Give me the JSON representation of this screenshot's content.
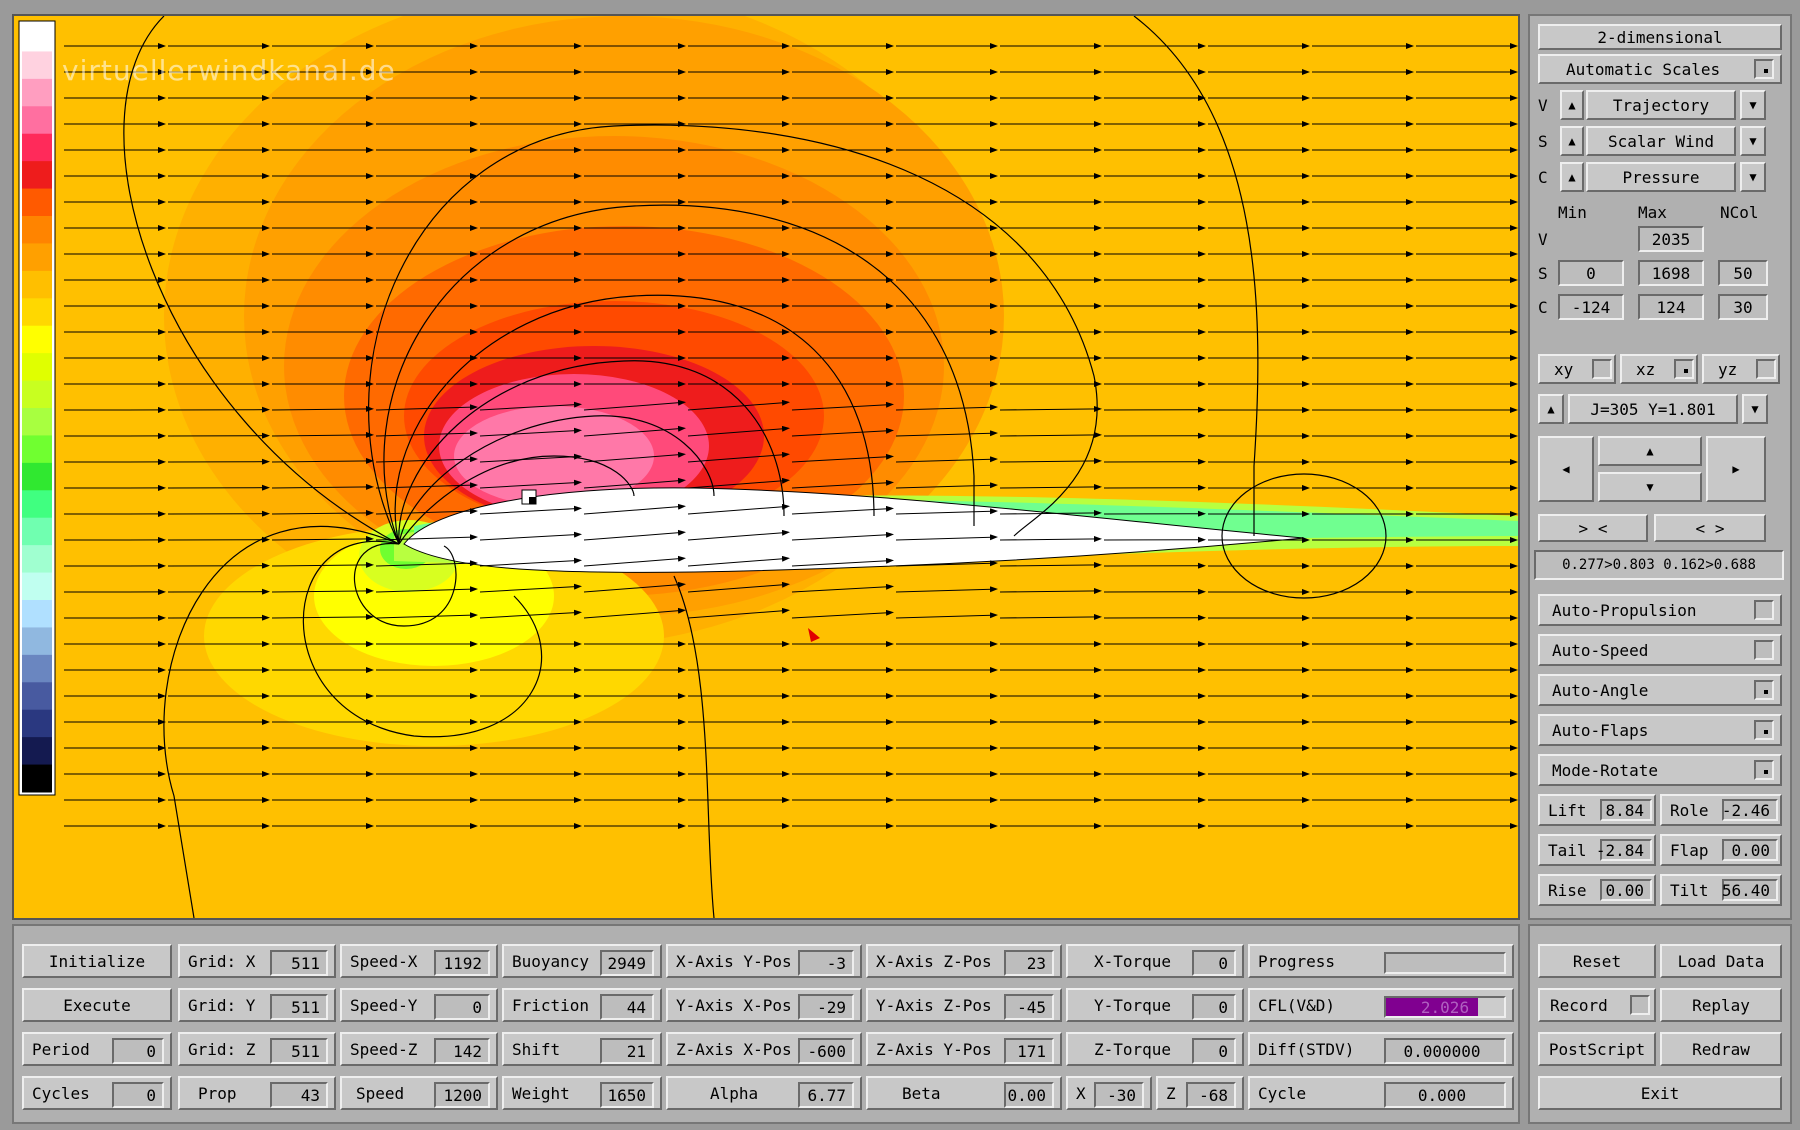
{
  "watermark": "virtuellerwindkanal.de",
  "colors": {
    "palette": [
      "#ffffff",
      "#ffd2e0",
      "#ff9ec0",
      "#ff6fa0",
      "#ff2a5a",
      "#ee1c1c",
      "#ff5a00",
      "#ff8400",
      "#ffa000",
      "#ffbf00",
      "#ffd800",
      "#ffff00",
      "#e0ff00",
      "#c8ff20",
      "#a8ff40",
      "#70ff30",
      "#30e830",
      "#40ff80",
      "#70ffb0",
      "#a0ffd0",
      "#c0fff0",
      "#b0e0ff",
      "#90b8e0",
      "#6a86c0",
      "#485aa0",
      "#2a3880",
      "#141a50",
      "#000000"
    ],
    "background_flow": "#ffc000"
  },
  "view": {
    "mode_label": "2-dimensional",
    "scales_label": "Automatic Scales",
    "v_row": {
      "letter": "V",
      "label": "Trajectory"
    },
    "s_row": {
      "letter": "S",
      "label": "Scalar Wind"
    },
    "c_row": {
      "letter": "C",
      "label": "Pressure"
    },
    "headers": {
      "min": "Min",
      "max": "Max",
      "ncol": "NCol"
    },
    "v_vals": {
      "letter": "V",
      "max": "2035"
    },
    "s_vals": {
      "letter": "S",
      "min": "0",
      "max": "1698",
      "ncol": "50"
    },
    "c_vals": {
      "letter": "C",
      "min": "-124",
      "max": "124",
      "ncol": "30"
    },
    "planes": {
      "xy": "xy",
      "xz": "xz",
      "yz": "yz"
    },
    "slice_label": "J=305  Y=1.801",
    "zoom_in": "> <",
    "zoom_out": "< >",
    "range_readout": "0.277>0.803 0.162>0.688",
    "toggles": [
      "Auto-Propulsion",
      "Auto-Speed",
      "Auto-Angle",
      "Auto-Flaps",
      "Mode-Rotate"
    ],
    "forces": [
      {
        "label": "Lift",
        "value": "8.84",
        "label2": "Role",
        "value2": "-2.46"
      },
      {
        "label": "Tail",
        "value": "-2.84",
        "label2": "Flap",
        "value2": "0.00"
      },
      {
        "label": "Rise",
        "value": "0.00",
        "label2": "Tilt",
        "value2": "56.40"
      }
    ]
  },
  "controls": {
    "initialize": "Initialize",
    "execute": "Execute",
    "period": {
      "label": "Period",
      "value": "0"
    },
    "cycles": {
      "label": "Cycles",
      "value": "0"
    },
    "grid_x": {
      "label": "Grid: X",
      "value": "511"
    },
    "grid_y": {
      "label": "Grid: Y",
      "value": "511"
    },
    "grid_z": {
      "label": "Grid: Z",
      "value": "511"
    },
    "prop": {
      "label": "Prop",
      "value": "43"
    },
    "speed_x": {
      "label": "Speed-X",
      "value": "1192"
    },
    "speed_y": {
      "label": "Speed-Y",
      "value": "0"
    },
    "speed_z": {
      "label": "Speed-Z",
      "value": "142"
    },
    "speed": {
      "label": "Speed",
      "value": "1200"
    },
    "buoyancy": {
      "label": "Buoyancy",
      "value": "2949"
    },
    "friction": {
      "label": "Friction",
      "value": "44"
    },
    "shift": {
      "label": "Shift",
      "value": "21"
    },
    "weight": {
      "label": "Weight",
      "value": "1650"
    },
    "xaxis_ypos": {
      "label": "X-Axis Y-Pos",
      "value": "-3"
    },
    "yaxis_xpos": {
      "label": "Y-Axis X-Pos",
      "value": "-29"
    },
    "zaxis_xpos": {
      "label": "Z-Axis X-Pos",
      "value": "-600"
    },
    "alpha": {
      "label": "Alpha",
      "value": "6.77"
    },
    "xaxis_zpos": {
      "label": "X-Axis Z-Pos",
      "value": "23"
    },
    "yaxis_zpos": {
      "label": "Y-Axis Z-Pos",
      "value": "-45"
    },
    "zaxis_ypos": {
      "label": "Z-Axis Y-Pos",
      "value": "171"
    },
    "beta": {
      "label": "Beta",
      "value": "0.00"
    },
    "x_torque": {
      "label": "X-Torque",
      "value": "0"
    },
    "y_torque": {
      "label": "Y-Torque",
      "value": "0"
    },
    "z_torque": {
      "label": "Z-Torque",
      "value": "0"
    },
    "x_small": {
      "label": "X",
      "value": "-30"
    },
    "z_small": {
      "label": "Z",
      "value": "-68"
    },
    "progress": {
      "label": "Progress"
    },
    "cfl": {
      "label": "CFL(V&D)",
      "value": "2.026",
      "color": "#800090"
    },
    "diff": {
      "label": "Diff(STDV)",
      "value": "0.000000"
    },
    "cycle": {
      "label": "Cycle",
      "value": "0.000"
    },
    "reset": "Reset",
    "load_data": "Load Data",
    "record": "Record",
    "replay": "Replay",
    "postscript": "PostScript",
    "redraw": "Redraw",
    "exit": "Exit"
  }
}
